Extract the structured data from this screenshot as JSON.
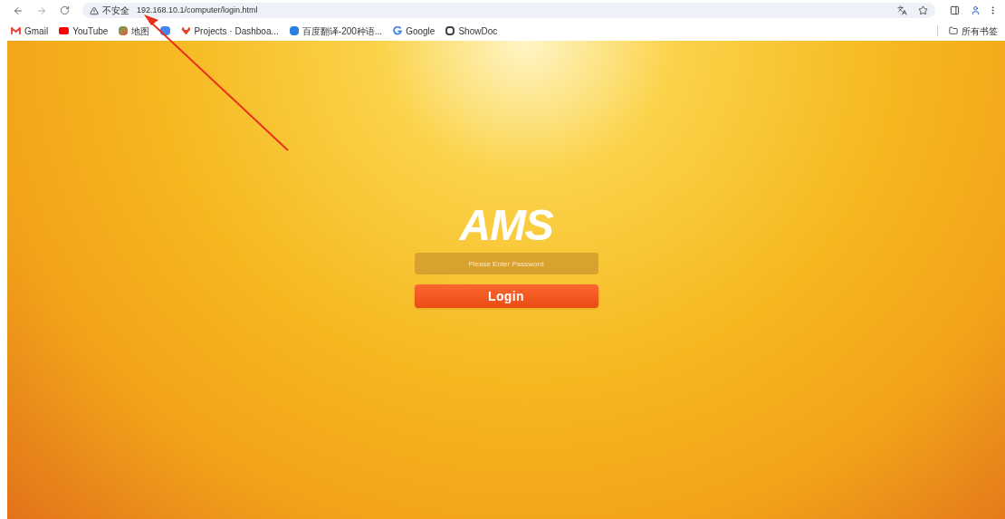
{
  "browser": {
    "security_label": "不安全",
    "url": "192.168.10.1/computer/login.html"
  },
  "bookmarks": [
    {
      "kind": "gmail",
      "label": "Gmail"
    },
    {
      "kind": "youtube",
      "label": "YouTube"
    },
    {
      "kind": "maps",
      "label": "地图"
    },
    {
      "kind": "translate"
    },
    {
      "kind": "gitlab",
      "label": "Projects · Dashboa..."
    },
    {
      "kind": "baidu",
      "label": "百度翻译-200种语..."
    },
    {
      "kind": "google",
      "label": "Google"
    },
    {
      "kind": "doc",
      "label": "ShowDoc"
    }
  ],
  "all_bookmarks": "所有书签",
  "login": {
    "logo": "AMS",
    "password": {
      "placeholder": "Please Enter Password"
    },
    "button": "Login"
  }
}
